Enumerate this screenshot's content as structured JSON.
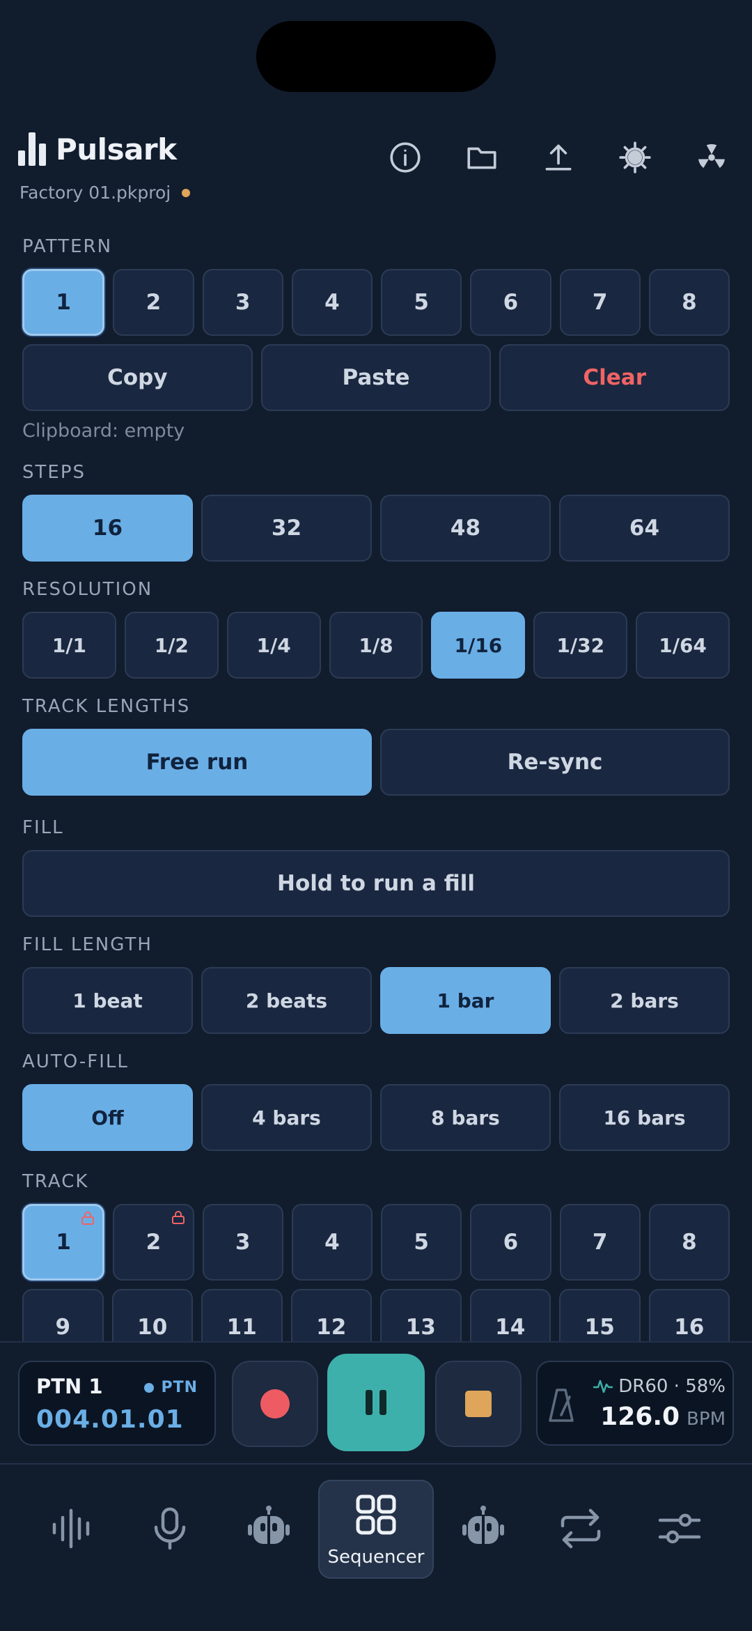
{
  "app": {
    "name": "Pulsark",
    "project": "Factory 01.pkproj"
  },
  "header": {
    "icons": [
      "info-icon",
      "folder-icon",
      "upload-icon",
      "brightness-icon",
      "radiation-icon"
    ]
  },
  "pattern": {
    "label": "PATTERN",
    "items": [
      "1",
      "2",
      "3",
      "4",
      "5",
      "6",
      "7",
      "8"
    ],
    "selected": "1",
    "copy_label": "Copy",
    "paste_label": "Paste",
    "clear_label": "Clear",
    "clipboard_status": "Clipboard: empty"
  },
  "steps": {
    "label": "STEPS",
    "options": [
      "16",
      "32",
      "48",
      "64"
    ],
    "selected": "16"
  },
  "resolution": {
    "label": "RESOLUTION",
    "options": [
      "1/1",
      "1/2",
      "1/4",
      "1/8",
      "1/16",
      "1/32",
      "1/64"
    ],
    "selected": "1/16"
  },
  "track_lengths": {
    "label": "TRACK LENGTHS",
    "options": [
      "Free run",
      "Re-sync"
    ],
    "selected": "Free run"
  },
  "fill": {
    "label": "FILL",
    "button_label": "Hold to run a fill"
  },
  "fill_length": {
    "label": "FILL LENGTH",
    "options": [
      "1 beat",
      "2 beats",
      "1 bar",
      "2 bars"
    ],
    "selected": "1 bar"
  },
  "auto_fill": {
    "label": "AUTO-FILL",
    "options": [
      "Off",
      "4 bars",
      "8 bars",
      "16 bars"
    ],
    "selected": "Off"
  },
  "track": {
    "label": "TRACK",
    "row1": [
      "1",
      "2",
      "3",
      "4",
      "5",
      "6",
      "7",
      "8"
    ],
    "row2": [
      "9",
      "10",
      "11",
      "12",
      "13",
      "14",
      "15",
      "16"
    ],
    "selected": "1",
    "locked": [
      "1",
      "2"
    ]
  },
  "transport": {
    "pattern_name": "PTN 1",
    "mode_tag": "PTN",
    "position": "004.01.01",
    "machine": "DR60 · 58%",
    "bpm": "126.0",
    "bpm_unit": "BPM"
  },
  "tabs": {
    "items": [
      "waveform-icon",
      "microphone-icon",
      "robot-icon",
      "grid-icon",
      "robot-icon",
      "repeat-icon",
      "sliders-icon"
    ],
    "active_label": "Sequencer"
  },
  "colors": {
    "background": "#111c2d",
    "accent": "#6aaee6",
    "danger": "#f06464",
    "play": "#3eb0ab",
    "record": "#ef5b62",
    "stop": "#dfa55a",
    "modified_dot": "#e0a55a"
  }
}
